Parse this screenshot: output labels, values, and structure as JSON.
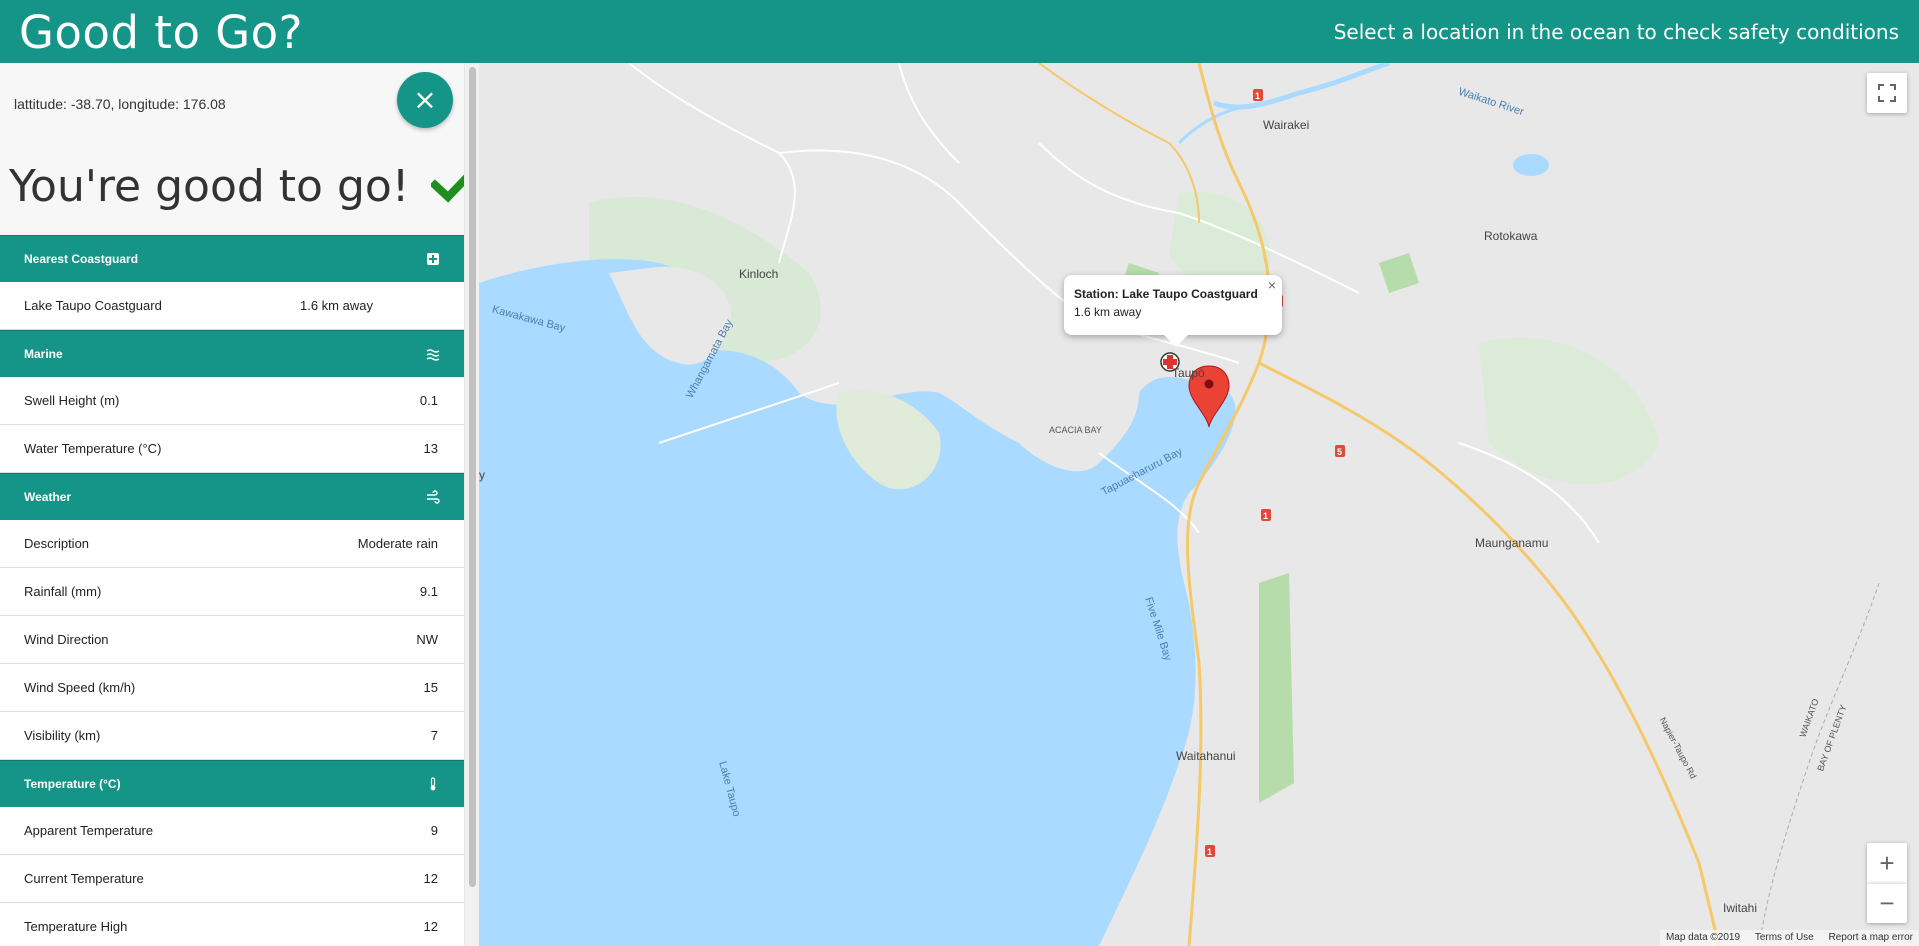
{
  "header": {
    "title": "Good to Go?",
    "tagline": "Select a location in the ocean to check safety conditions"
  },
  "sidebar": {
    "coordinates": "lattitude: -38.70, longitude: 176.08",
    "close_icon": "×",
    "verdict": "You're good to go!",
    "sections": {
      "coastguard": {
        "title": "Nearest Coastguard",
        "icon": "medical-cross-icon",
        "station": "Lake Taupo Coastguard",
        "distance": "1.6 km away"
      },
      "marine": {
        "title": "Marine",
        "icon": "waves-icon",
        "rows": [
          {
            "label": "Swell Height (m)",
            "value": "0.1"
          },
          {
            "label": "Water Temperature (°C)",
            "value": "13"
          }
        ]
      },
      "weather": {
        "title": "Weather",
        "icon": "wind-icon",
        "rows": [
          {
            "label": "Description",
            "value": "Moderate rain"
          },
          {
            "label": "Rainfall (mm)",
            "value": "9.1"
          },
          {
            "label": "Wind Direction",
            "value": "NW"
          },
          {
            "label": "Wind Speed (km/h)",
            "value": "15"
          },
          {
            "label": "Visibility (km)",
            "value": "7"
          }
        ]
      },
      "temperature": {
        "title": "Temperature (°C)",
        "icon": "thermometer-icon",
        "rows": [
          {
            "label": "Apparent Temperature",
            "value": "9"
          },
          {
            "label": "Current Temperature",
            "value": "12"
          },
          {
            "label": "Temperature High",
            "value": "12"
          }
        ]
      }
    }
  },
  "map": {
    "infowindow": {
      "title": "Station: Lake Taupo Coastguard",
      "subtitle": "1.6 km away",
      "close": "×"
    },
    "labels": {
      "wairakei": "Wairakei",
      "waikato_river": "Waikato River",
      "rotokawa": "Rotokawa",
      "kinloch": "Kinloch",
      "kawakawa_bay": "Kawakawa Bay",
      "whangamata_bay": "Whangamata Bay",
      "acacia_bay": "ACACIA BAY",
      "tapuaeharuru_bay": "Tapuaeharuru Bay",
      "taupo": "Taupō",
      "maunganamu": "Maunganamu",
      "five_mile_bay": "Five Mile Bay",
      "lake_taupo": "Lake Taupo",
      "waitahanui": "Waitahanui",
      "napier_taupo_rd": "Napier-Taupo Rd",
      "iwitahi": "Iwitahi",
      "waikato": "WAIKATO",
      "bay_of_plenty": "BAY OF PLENTY",
      "hwy_1": "1",
      "hwy_5": "5",
      "bay_fragment": "y"
    },
    "controls": {
      "zoom_in": "+",
      "zoom_out": "−"
    },
    "attribution": {
      "data": "Map data ©2019",
      "terms": "Terms of Use",
      "report": "Report a map error"
    }
  },
  "colors": {
    "brand": "#159587",
    "water": "#aadaff",
    "land": "#e8e8e8",
    "park": "#c8e6c4",
    "check": "#1e8e1e",
    "marker": "#ea4335"
  }
}
